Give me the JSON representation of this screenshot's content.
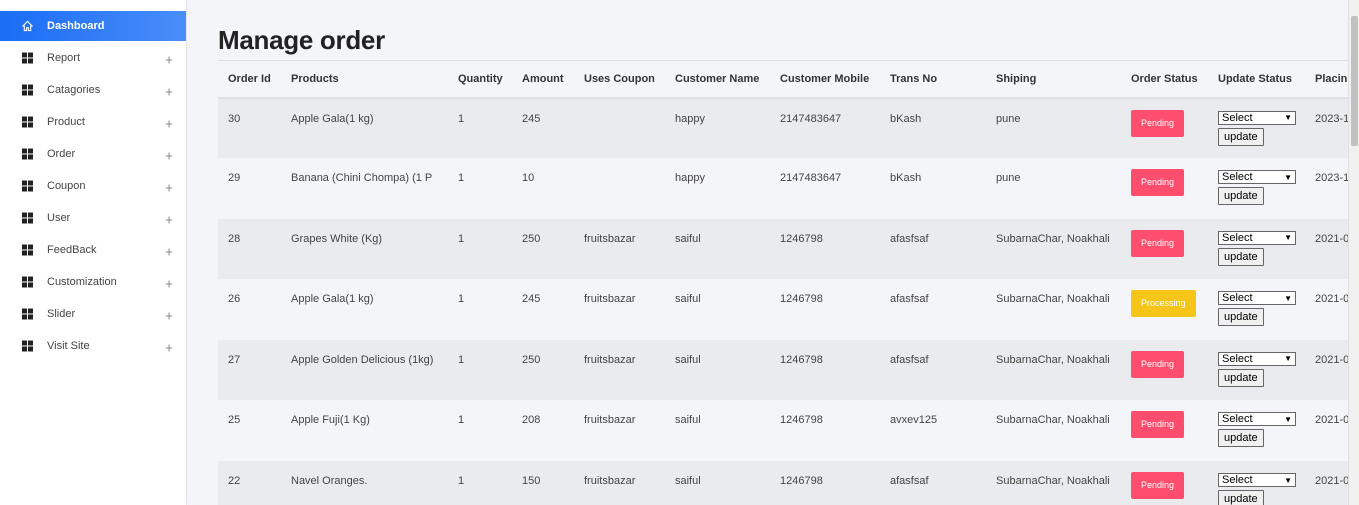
{
  "sidebar": {
    "items": [
      {
        "label": "Dashboard",
        "icon": "home-icon",
        "active": true
      },
      {
        "label": "Report",
        "icon": "grid-icon"
      },
      {
        "label": "Catagories",
        "icon": "grid-icon"
      },
      {
        "label": "Product",
        "icon": "grid-icon"
      },
      {
        "label": "Order",
        "icon": "grid-icon"
      },
      {
        "label": "Coupon",
        "icon": "grid-icon"
      },
      {
        "label": "User",
        "icon": "grid-icon"
      },
      {
        "label": "FeedBack",
        "icon": "grid-icon"
      },
      {
        "label": "Customization",
        "icon": "grid-icon"
      },
      {
        "label": "Slider",
        "icon": "grid-icon"
      },
      {
        "label": "Visit Site",
        "icon": "grid-icon"
      }
    ],
    "expand_symbol": "+"
  },
  "page": {
    "title": "Manage order"
  },
  "table": {
    "headers": [
      "Order Id",
      "Products",
      "Quantity",
      "Amount",
      "Uses Coupon",
      "Customer Name",
      "Customer Mobile",
      "Trans No",
      "Shiping",
      "Order Status",
      "Update Status",
      "Placin"
    ],
    "rows": [
      {
        "order_id": "30",
        "product": "Apple Gala(1 kg)",
        "quantity": "1",
        "amount": "245",
        "coupon": "",
        "customer": "happy",
        "mobile": "2147483647",
        "trans_no": "bKash",
        "shipping": "pune",
        "status": "Pending",
        "select": "Select",
        "update": "update",
        "placed": "2023-1"
      },
      {
        "order_id": "29",
        "product": "Banana (Chini Chompa) (1 P",
        "quantity": "1",
        "amount": "10",
        "coupon": "",
        "customer": "happy",
        "mobile": "2147483647",
        "trans_no": "bKash",
        "shipping": "pune",
        "status": "Pending",
        "select": "Select",
        "update": "update",
        "placed": "2023-1"
      },
      {
        "order_id": "28",
        "product": "Grapes White (Kg)",
        "quantity": "1",
        "amount": "250",
        "coupon": "fruitsbazar",
        "customer": "saiful",
        "mobile": "1246798",
        "trans_no": "afasfsaf",
        "shipping": "SubarnaChar, Noakhali",
        "status": "Pending",
        "select": "Select",
        "update": "update",
        "placed": "2021-0"
      },
      {
        "order_id": "26",
        "product": "Apple Gala(1 kg)",
        "quantity": "1",
        "amount": "245",
        "coupon": "fruitsbazar",
        "customer": "saiful",
        "mobile": "1246798",
        "trans_no": "afasfsaf",
        "shipping": "SubarnaChar, Noakhali",
        "status": "Processing",
        "select": "Select",
        "update": "update",
        "placed": "2021-0"
      },
      {
        "order_id": "27",
        "product": "Apple Golden Delicious (1kg)",
        "quantity": "1",
        "amount": "250",
        "coupon": "fruitsbazar",
        "customer": "saiful",
        "mobile": "1246798",
        "trans_no": "afasfsaf",
        "shipping": "SubarnaChar, Noakhali",
        "status": "Pending",
        "select": "Select",
        "update": "update",
        "placed": "2021-0"
      },
      {
        "order_id": "25",
        "product": "Apple Fuji(1 Kg)",
        "quantity": "1",
        "amount": "208",
        "coupon": "fruitsbazar",
        "customer": "saiful",
        "mobile": "1246798",
        "trans_no": "avxev125",
        "shipping": "SubarnaChar, Noakhali",
        "status": "Pending",
        "select": "Select",
        "update": "update",
        "placed": "2021-0"
      },
      {
        "order_id": "22",
        "product": "Navel Oranges.",
        "quantity": "1",
        "amount": "150",
        "coupon": "fruitsbazar",
        "customer": "saiful",
        "mobile": "1246798",
        "trans_no": "afasfsaf",
        "shipping": "SubarnaChar, Noakhali",
        "status": "Pending",
        "select": "Select",
        "update": "update",
        "placed": "2021-0"
      }
    ]
  },
  "colors": {
    "accent": "#1a6df5",
    "pending": "#ff4d6d",
    "processing": "#f5c518"
  }
}
